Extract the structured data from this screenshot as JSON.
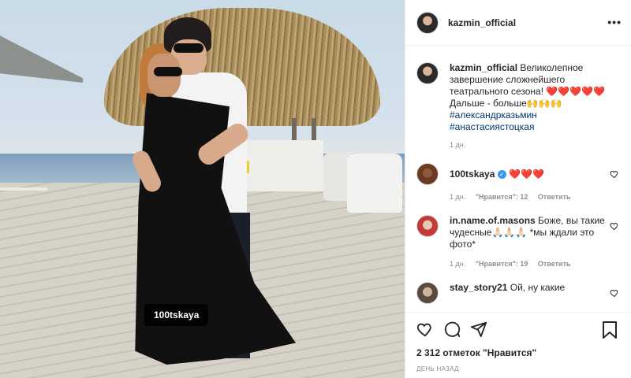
{
  "photo": {
    "tag_label": "100tskaya"
  },
  "header": {
    "username": "kazmin_official",
    "more_icon": "ellipsis-icon"
  },
  "caption": {
    "username": "kazmin_official",
    "text": "Великолепное завершение сложнейшего театрального сезона! ❤️❤️❤️❤️❤️ Дальше - больше🙌🙌🙌",
    "hashtags": [
      "#александрказьмин",
      "#анастасиястоцкая"
    ],
    "time": "1 дн."
  },
  "comments": [
    {
      "username": "100tskaya",
      "text": "❤️❤️❤️",
      "verified": true,
      "time": "1 дн.",
      "likes": "\"Нравится\": 12",
      "reply": "Ответить"
    },
    {
      "username": "in.name.of.masons",
      "text": "Боже, вы такие чудесные🙏🏻🙏🏻🙏🏻 *мы ждали это фото*",
      "time": "1 дн.",
      "likes": "\"Нравится\": 19",
      "reply": "Ответить"
    },
    {
      "username": "stay_story21",
      "text": "Ой, ну какие"
    }
  ],
  "actions": {
    "likes_text": "2 312 отметок \"Нравится\"",
    "date": "ДЕНЬ НАЗАД"
  },
  "colors": {
    "accent_link": "#00376b",
    "heart": "#e0245e",
    "verified": "#3897f0",
    "muted": "#8e8e8e"
  }
}
